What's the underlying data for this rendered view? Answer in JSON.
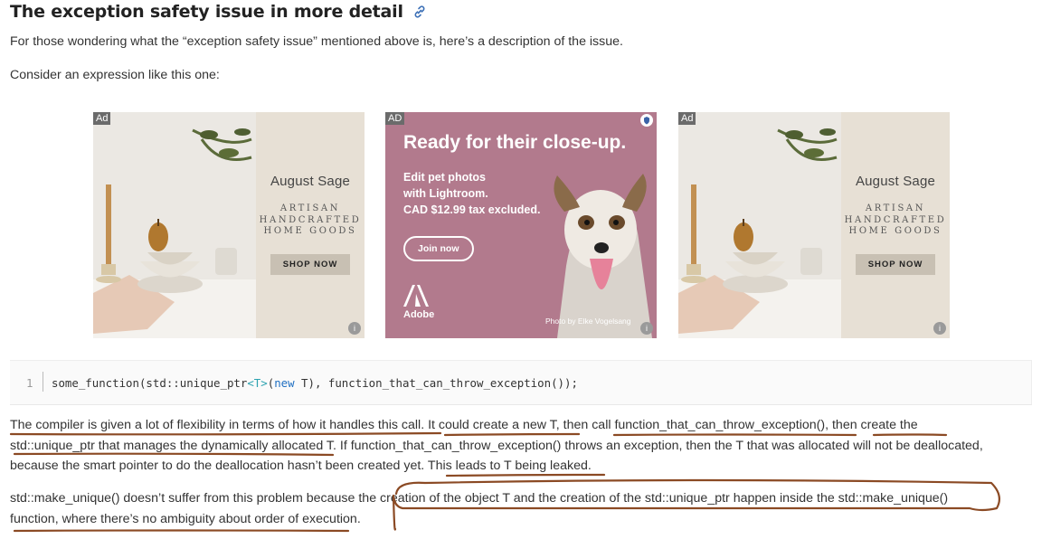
{
  "section": {
    "title": "The exception safety issue in more detail",
    "link_icon": "link-icon"
  },
  "intro": {
    "p1": "For those wondering what the “exception safety issue” mentioned above is, here’s a description of the issue.",
    "p2": "Consider an expression like this one:"
  },
  "ads": {
    "left": {
      "tag": "Ad",
      "brand": "August Sage",
      "tagline_1": "ARTISAN",
      "tagline_2": "HANDCRAFTED",
      "tagline_3": "HOME GOODS",
      "button": "SHOP NOW"
    },
    "middle": {
      "tag": "AD",
      "headline": "Ready for their close-up.",
      "copy": "Edit pet photos\nwith Lightroom.\nCAD $12.99 tax excluded.",
      "button": "Join now",
      "logo_label": "Adobe",
      "credit": "Photo by Elke Vogelsang"
    },
    "right": {
      "tag": "Ad",
      "brand": "August Sage",
      "tagline_1": "ARTISAN",
      "tagline_2": "HANDCRAFTED",
      "tagline_3": "HOME GOODS",
      "button": "SHOP NOW"
    },
    "info_glyph": "i"
  },
  "code": {
    "line_number": "1",
    "t1": "some_function(std::unique_ptr",
    "t2": "<T>",
    "t3": "(",
    "t4": "new",
    "t5": " T), function_that_can_throw_exception());"
  },
  "explanation": {
    "line1": "The compiler is given a lot of flexibility in terms of how it handles this call. It could create a new T, then call function_that_can_throw_exception(), then create the",
    "line2": "std::unique_ptr that manages the dynamically allocated T. If function_that_can_throw_exception() throws an exception, then the T that was allocated will not be deallocated,",
    "line3": "because the smart pointer to do the deallocation hasn’t been created yet. This leads to T being leaked."
  },
  "make_unique": {
    "line1": "std::make_unique() doesn’t suffer from this problem because the creation of the object T and the creation of the std::unique_ptr happen inside the std::make_unique()",
    "line2": "function, where there’s no ambiguity about order of execution."
  },
  "colors": {
    "annotation": "#8b4a24",
    "adobe_bg": "#b27a8d",
    "code_type": "#2ba2b0",
    "code_keyword": "#1f6fc2"
  }
}
